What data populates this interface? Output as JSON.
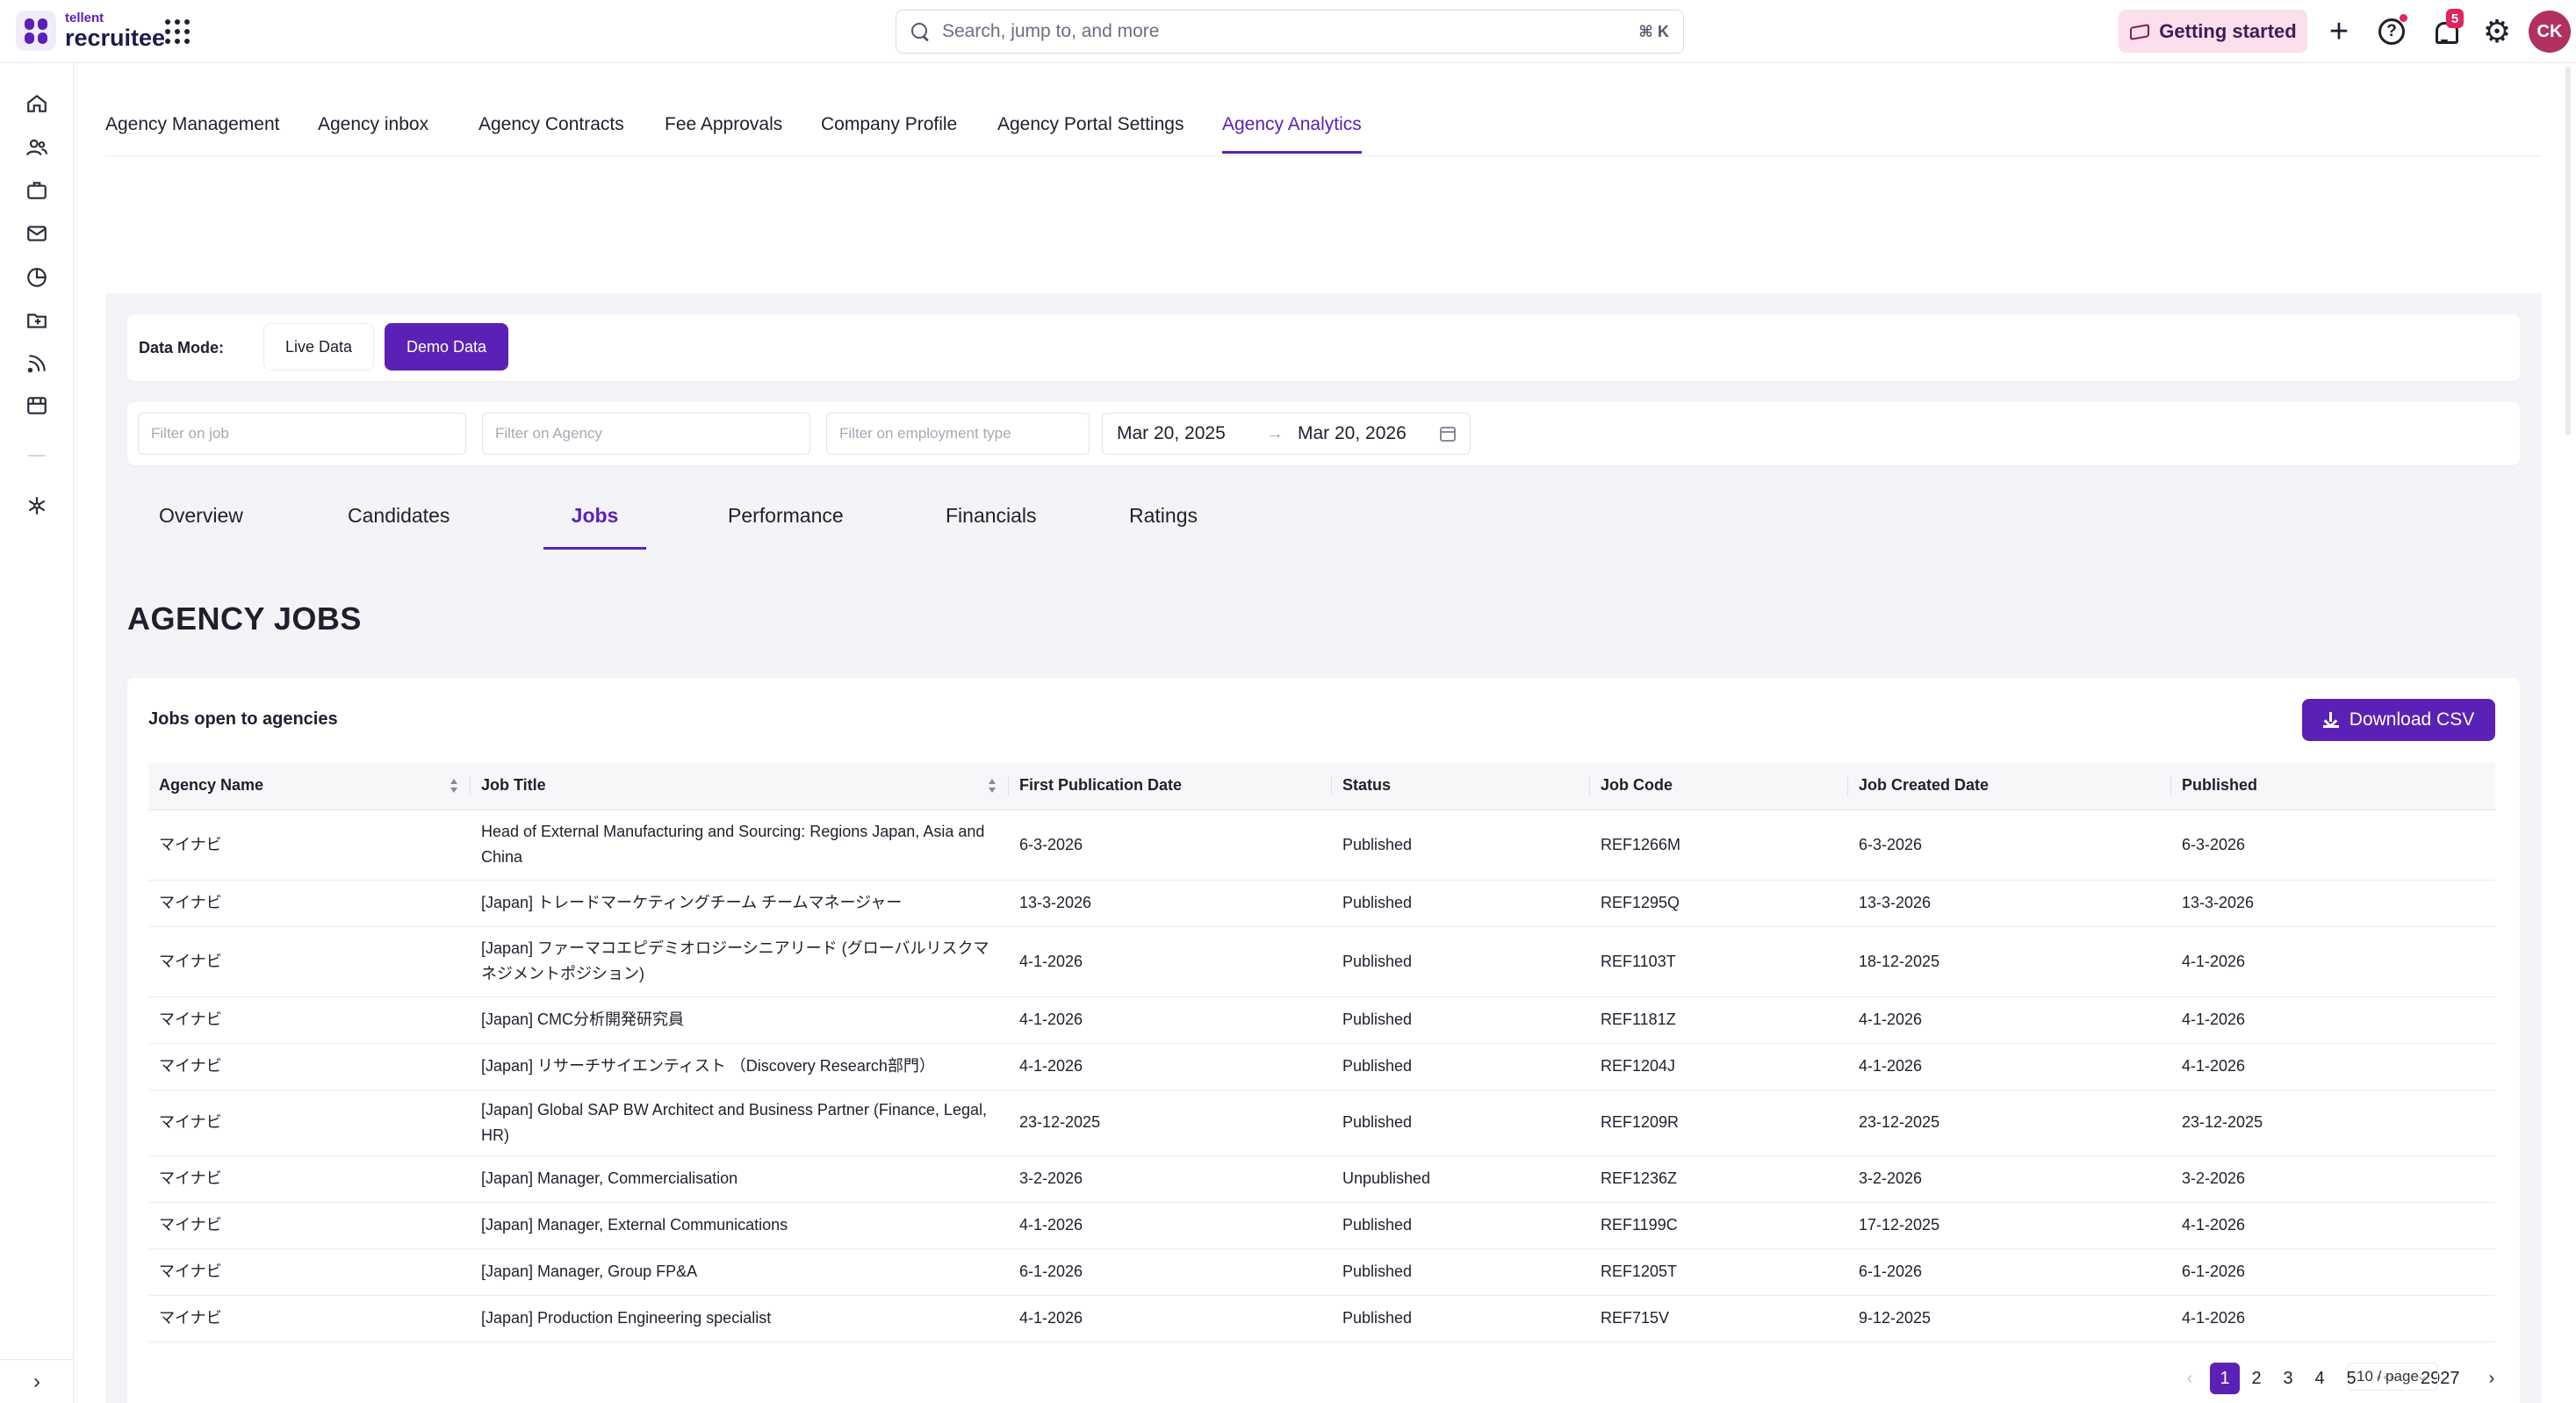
{
  "brand": {
    "small": "tellent",
    "big": "recruitee",
    "accent": "#5b21b6"
  },
  "header": {
    "search_placeholder": "Search, jump to, and more",
    "search_shortcut": "⌘ K",
    "getting_started": "Getting started",
    "notification_count": "5",
    "avatar_initials": "CK"
  },
  "top_tabs": [
    {
      "label": "Agency Management"
    },
    {
      "label": "Agency inbox"
    },
    {
      "label": "Agency Contracts"
    },
    {
      "label": "Fee Approvals"
    },
    {
      "label": "Company Profile"
    },
    {
      "label": "Agency Portal Settings"
    },
    {
      "label": "Agency Analytics",
      "active": true
    }
  ],
  "data_mode": {
    "label": "Data Mode:",
    "live": "Live Data",
    "demo": "Demo Data",
    "selected": "Demo Data"
  },
  "filters": {
    "job_placeholder": "Filter on job",
    "agency_placeholder": "Filter on Agency",
    "employment_placeholder": "Filter on employment type",
    "date_from": "Mar 20, 2025",
    "date_to": "Mar 20, 2026",
    "arrow": "→"
  },
  "sub_tabs": [
    {
      "label": "Overview"
    },
    {
      "label": "Candidates"
    },
    {
      "label": "Jobs",
      "active": true
    },
    {
      "label": "Performance"
    },
    {
      "label": "Financials"
    },
    {
      "label": "Ratings"
    }
  ],
  "section_title": "AGENCY JOBS",
  "table_card": {
    "title": "Jobs open to agencies",
    "download": "Download CSV",
    "columns": [
      "Agency Name",
      "Job Title",
      "First Publication Date",
      "Status",
      "Job Code",
      "Job Created Date",
      "Published"
    ],
    "rows": [
      [
        "マイナビ",
        "Head of External Manufacturing and Sourcing: Regions Japan, Asia and China",
        "6-3-2026",
        "Published",
        "REF1266M",
        "6-3-2026",
        "6-3-2026"
      ],
      [
        "マイナビ",
        "[Japan] トレードマーケティングチーム チームマネージャー",
        "13-3-2026",
        "Published",
        "REF1295Q",
        "13-3-2026",
        "13-3-2026"
      ],
      [
        "マイナビ",
        "[Japan] ファーマコエピデミオロジーシニアリード (グローバルリスクマネジメントポジション)",
        "4-1-2026",
        "Published",
        "REF1103T",
        "18-12-2025",
        "4-1-2026"
      ],
      [
        "マイナビ",
        "[Japan] CMC分析開発研究員",
        "4-1-2026",
        "Published",
        "REF1181Z",
        "4-1-2026",
        "4-1-2026"
      ],
      [
        "マイナビ",
        "[Japan] リサーチサイエンティスト （Discovery Research部門）",
        "4-1-2026",
        "Published",
        "REF1204J",
        "4-1-2026",
        "4-1-2026"
      ],
      [
        "マイナビ",
        "[Japan] Global SAP BW Architect and Business Partner (Finance, Legal, HR)",
        "23-12-2025",
        "Published",
        "REF1209R",
        "23-12-2025",
        "23-12-2025"
      ],
      [
        "マイナビ",
        "[Japan] Manager, Commercialisation",
        "3-2-2026",
        "Unpublished",
        "REF1236Z",
        "3-2-2026",
        "3-2-2026"
      ],
      [
        "マイナビ",
        "[Japan] Manager, External Communications",
        "4-1-2026",
        "Published",
        "REF1199C",
        "17-12-2025",
        "4-1-2026"
      ],
      [
        "マイナビ",
        "[Japan] Manager, Group FP&A",
        "6-1-2026",
        "Published",
        "REF1205T",
        "6-1-2026",
        "6-1-2026"
      ],
      [
        "マイナビ",
        "[Japan] Production Engineering specialist",
        "4-1-2026",
        "Published",
        "REF715V",
        "9-12-2025",
        "4-1-2026"
      ]
    ]
  },
  "pagination": {
    "prev": "‹",
    "pages": [
      "1",
      "2",
      "3",
      "4",
      "5"
    ],
    "ellipsis": "•••",
    "last": "2927",
    "next": "›",
    "page_size": "10 / page",
    "current": "1"
  }
}
